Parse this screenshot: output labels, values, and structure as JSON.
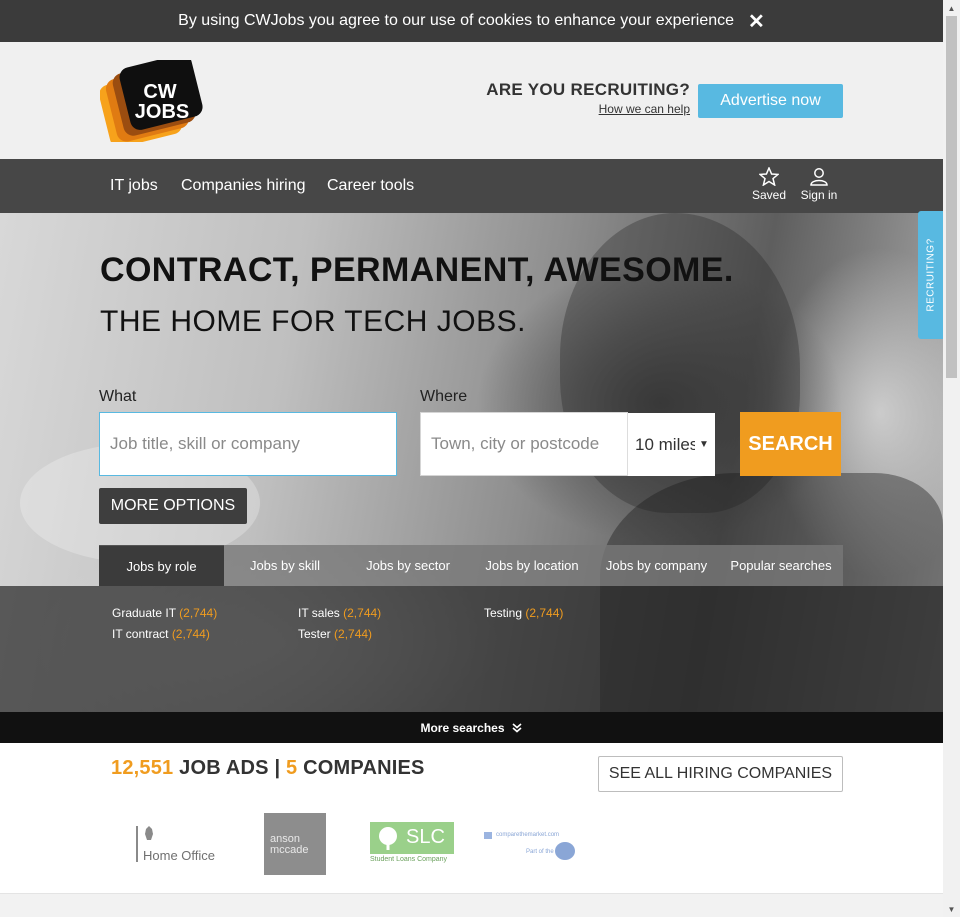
{
  "cookie_bar": {
    "text": "By using CWJobs you agree to our use of cookies to enhance your experience",
    "close": "✕"
  },
  "header": {
    "logo_line1": "CW",
    "logo_line2": "JOBS",
    "recruiting_question": "ARE YOU RECRUITING?",
    "recruiting_link": "How we can help",
    "advertise_button": "Advertise now"
  },
  "nav": {
    "items": [
      "IT jobs",
      "Companies hiring",
      "Career tools"
    ],
    "saved": "Saved",
    "sign_in": "Sign in"
  },
  "hero": {
    "headline": "CONTRACT, PERMANENT, AWESOME.",
    "subheadline": "THE HOME FOR TECH JOBS."
  },
  "search": {
    "what_label": "What",
    "what_placeholder": "Job title, skill or company",
    "where_label": "Where",
    "where_placeholder": "Town, city or postcode",
    "radius": "10 miles",
    "search_button": "SEARCH",
    "more_options": "MORE OPTIONS"
  },
  "tabs": [
    "Jobs by role",
    "Jobs by skill",
    "Jobs by sector",
    "Jobs by location",
    "Jobs by company",
    "Popular searches"
  ],
  "active_tab": "Jobs by role",
  "popular": [
    {
      "label": "Graduate IT",
      "count": "(2,744)"
    },
    {
      "label": "IT contract",
      "count": "(2,744)"
    },
    {
      "label": "IT sales",
      "count": "(2,744)"
    },
    {
      "label": "Tester",
      "count": "(2,744)"
    },
    {
      "label": "Testing",
      "count": "(2,744)"
    }
  ],
  "more_searches": "More searches",
  "stats": {
    "job_count": "12,551",
    "job_label": "JOB ADS",
    "separator": "|",
    "company_count": "5",
    "company_label": "COMPANIES"
  },
  "see_all_button": "SEE ALL HIRING COMPANIES",
  "companies": {
    "home_office": "Home Office",
    "anson_line1": "anson",
    "anson_line2": "mccade",
    "slc": "SLC",
    "slc_sub": "Student Loans Company",
    "ctm": "comparethemarket.com",
    "ctm_sub": "Part of the"
  },
  "side_tab": "RECRUITING?",
  "colors": {
    "accent_orange": "#f09c1f",
    "accent_blue": "#58b9e1",
    "nav_bg": "#474747",
    "cookie_bg": "#3b3b3b"
  },
  "icons": [
    "close-icon",
    "star-icon",
    "user-icon",
    "dropdown-arrow-icon",
    "double-chevron-down-icon"
  ]
}
